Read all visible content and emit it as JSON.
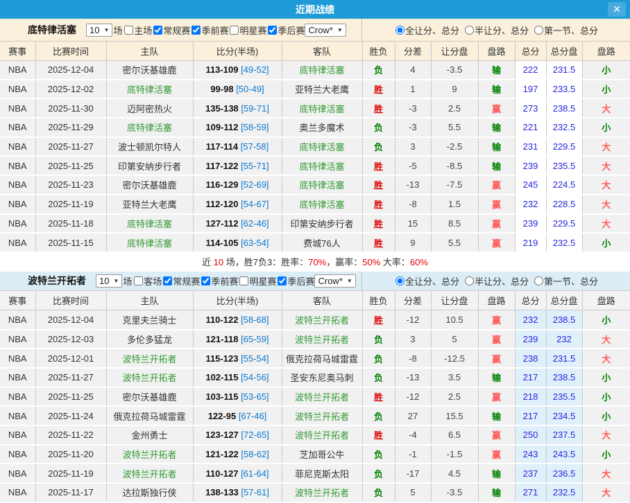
{
  "titlebar": {
    "title": "近期战绩",
    "close_icon": "✕"
  },
  "colors": {
    "titlebar_blue": "#1E9AD6",
    "section1_filter_bg": "#FAF0DB",
    "section2_filter_bg": "#DCEDF5",
    "row_bg": "#F1F1F1",
    "total_highlight_blue": "#DFF0FB",
    "win_red": "#DD0000",
    "lose_green": "#008000",
    "cover_light_red": "#FF5C5C",
    "total_value_blue": "#2626DD",
    "half_score_blue": "#0B76CC",
    "team_green": "#339933",
    "summary_red": "#E60000"
  },
  "columns": [
    "赛事",
    "比赛时间",
    "主队",
    "比分(半场)",
    "客队",
    "胜负",
    "分差",
    "让分盘",
    "盘路",
    "总分",
    "总分盘",
    "盘路"
  ],
  "sections": [
    {
      "team": "底特律活塞",
      "games_count": "10",
      "games_suffix": "场",
      "checkboxes": [
        {
          "label": "主场",
          "checked": false
        },
        {
          "label": "常规赛",
          "checked": true
        },
        {
          "label": "季前赛",
          "checked": true
        },
        {
          "label": "明星赛",
          "checked": false
        },
        {
          "label": "季后赛",
          "checked": true
        }
      ],
      "dropdown": "Crow*",
      "radios": [
        {
          "label": "全让分、总分",
          "checked": true
        },
        {
          "label": "半让分、总分",
          "checked": false
        },
        {
          "label": "第一节、总分",
          "checked": false
        }
      ],
      "rows": [
        {
          "league": "NBA",
          "date": "2025-12-04",
          "home": "密尔沃基雄鹿",
          "home_green": false,
          "score": "113-109",
          "half": "[49-52]",
          "away": "底特律活塞",
          "away_green": true,
          "result": "负",
          "diff": "4",
          "handicap": "-3.5",
          "handicap_result": "输",
          "total": "222",
          "total_line": "231.5",
          "ou": "小"
        },
        {
          "league": "NBA",
          "date": "2025-12-02",
          "home": "底特律活塞",
          "home_green": true,
          "score": "99-98",
          "half": "[50-49]",
          "away": "亚特兰大老鹰",
          "away_green": false,
          "result": "胜",
          "diff": "1",
          "handicap": "9",
          "handicap_result": "输",
          "total": "197",
          "total_line": "233.5",
          "ou": "小"
        },
        {
          "league": "NBA",
          "date": "2025-11-30",
          "home": "迈阿密热火",
          "home_green": false,
          "score": "135-138",
          "half": "[59-71]",
          "away": "底特律活塞",
          "away_green": true,
          "result": "胜",
          "diff": "-3",
          "handicap": "2.5",
          "handicap_result": "赢",
          "total": "273",
          "total_line": "238.5",
          "ou": "大"
        },
        {
          "league": "NBA",
          "date": "2025-11-29",
          "home": "底特律活塞",
          "home_green": true,
          "score": "109-112",
          "half": "[58-59]",
          "away": "奥兰多魔术",
          "away_green": false,
          "result": "负",
          "diff": "-3",
          "handicap": "5.5",
          "handicap_result": "输",
          "total": "221",
          "total_line": "232.5",
          "ou": "小"
        },
        {
          "league": "NBA",
          "date": "2025-11-27",
          "home": "波士顿凯尔特人",
          "home_green": false,
          "score": "117-114",
          "half": "[57-58]",
          "away": "底特律活塞",
          "away_green": true,
          "result": "负",
          "diff": "3",
          "handicap": "-2.5",
          "handicap_result": "输",
          "total": "231",
          "total_line": "229.5",
          "ou": "大"
        },
        {
          "league": "NBA",
          "date": "2025-11-25",
          "home": "印第安纳步行者",
          "home_green": false,
          "score": "117-122",
          "half": "[55-71]",
          "away": "底特律活塞",
          "away_green": true,
          "result": "胜",
          "diff": "-5",
          "handicap": "-8.5",
          "handicap_result": "输",
          "total": "239",
          "total_line": "235.5",
          "ou": "大"
        },
        {
          "league": "NBA",
          "date": "2025-11-23",
          "home": "密尔沃基雄鹿",
          "home_green": false,
          "score": "116-129",
          "half": "[52-69]",
          "away": "底特律活塞",
          "away_green": true,
          "result": "胜",
          "diff": "-13",
          "handicap": "-7.5",
          "handicap_result": "赢",
          "total": "245",
          "total_line": "224.5",
          "ou": "大"
        },
        {
          "league": "NBA",
          "date": "2025-11-19",
          "home": "亚特兰大老鹰",
          "home_green": false,
          "score": "112-120",
          "half": "[54-67]",
          "away": "底特律活塞",
          "away_green": true,
          "result": "胜",
          "diff": "-8",
          "handicap": "1.5",
          "handicap_result": "赢",
          "total": "232",
          "total_line": "228.5",
          "ou": "大"
        },
        {
          "league": "NBA",
          "date": "2025-11-18",
          "home": "底特律活塞",
          "home_green": true,
          "score": "127-112",
          "half": "[62-46]",
          "away": "印第安纳步行者",
          "away_green": false,
          "result": "胜",
          "diff": "15",
          "handicap": "8.5",
          "handicap_result": "赢",
          "total": "239",
          "total_line": "229.5",
          "ou": "大"
        },
        {
          "league": "NBA",
          "date": "2025-11-15",
          "home": "底特律活塞",
          "home_green": true,
          "score": "114-105",
          "half": "[63-54]",
          "away": "费城76人",
          "away_green": false,
          "result": "胜",
          "diff": "9",
          "handicap": "5.5",
          "handicap_result": "赢",
          "total": "219",
          "total_line": "232.5",
          "ou": "小"
        }
      ],
      "summary": [
        {
          "text": "近 ",
          "red": false
        },
        {
          "text": "10",
          "red": true
        },
        {
          "text": " 场，胜7负3：胜率：",
          "red": false
        },
        {
          "text": "70%",
          "red": true
        },
        {
          "text": "，赢率：",
          "red": false
        },
        {
          "text": "50%",
          "red": true
        },
        {
          "text": " 大率：",
          "red": false
        },
        {
          "text": "60%",
          "red": true
        }
      ]
    },
    {
      "team": "波特兰开拓者",
      "games_count": "10",
      "games_suffix": "场",
      "checkboxes": [
        {
          "label": "客场",
          "checked": false
        },
        {
          "label": "常规赛",
          "checked": true
        },
        {
          "label": "季前赛",
          "checked": true
        },
        {
          "label": "明星赛",
          "checked": false
        },
        {
          "label": "季后赛",
          "checked": true
        }
      ],
      "dropdown": "Crow*",
      "radios": [
        {
          "label": "全让分、总分",
          "checked": true
        },
        {
          "label": "半让分、总分",
          "checked": false
        },
        {
          "label": "第一节、总分",
          "checked": false
        }
      ],
      "rows": [
        {
          "league": "NBA",
          "date": "2025-12-04",
          "home": "克里夫兰骑士",
          "home_green": false,
          "score": "110-122",
          "half": "[58-68]",
          "away": "波特兰开拓者",
          "away_green": true,
          "result": "胜",
          "diff": "-12",
          "handicap": "10.5",
          "handicap_result": "赢",
          "total": "232",
          "total_line": "238.5",
          "ou": "小"
        },
        {
          "league": "NBA",
          "date": "2025-12-03",
          "home": "多伦多猛龙",
          "home_green": false,
          "score": "121-118",
          "half": "[65-59]",
          "away": "波特兰开拓者",
          "away_green": true,
          "result": "负",
          "diff": "3",
          "handicap": "5",
          "handicap_result": "赢",
          "total": "239",
          "total_line": "232",
          "ou": "大"
        },
        {
          "league": "NBA",
          "date": "2025-12-01",
          "home": "波特兰开拓者",
          "home_green": true,
          "score": "115-123",
          "half": "[55-54]",
          "away": "俄克拉荷马城雷霆",
          "away_green": false,
          "result": "负",
          "diff": "-8",
          "handicap": "-12.5",
          "handicap_result": "赢",
          "total": "238",
          "total_line": "231.5",
          "ou": "大"
        },
        {
          "league": "NBA",
          "date": "2025-11-27",
          "home": "波特兰开拓者",
          "home_green": true,
          "score": "102-115",
          "half": "[54-56]",
          "away": "圣安东尼奥马刺",
          "away_green": false,
          "result": "负",
          "diff": "-13",
          "handicap": "3.5",
          "handicap_result": "输",
          "total": "217",
          "total_line": "238.5",
          "ou": "小"
        },
        {
          "league": "NBA",
          "date": "2025-11-25",
          "home": "密尔沃基雄鹿",
          "home_green": false,
          "score": "103-115",
          "half": "[53-65]",
          "away": "波特兰开拓者",
          "away_green": true,
          "result": "胜",
          "diff": "-12",
          "handicap": "2.5",
          "handicap_result": "赢",
          "total": "218",
          "total_line": "235.5",
          "ou": "小"
        },
        {
          "league": "NBA",
          "date": "2025-11-24",
          "home": "俄克拉荷马城雷霆",
          "home_green": false,
          "score": "122-95",
          "half": "[67-46]",
          "away": "波特兰开拓者",
          "away_green": true,
          "result": "负",
          "diff": "27",
          "handicap": "15.5",
          "handicap_result": "输",
          "total": "217",
          "total_line": "234.5",
          "ou": "小"
        },
        {
          "league": "NBA",
          "date": "2025-11-22",
          "home": "金州勇士",
          "home_green": false,
          "score": "123-127",
          "half": "[72-65]",
          "away": "波特兰开拓者",
          "away_green": true,
          "result": "胜",
          "diff": "-4",
          "handicap": "6.5",
          "handicap_result": "赢",
          "total": "250",
          "total_line": "237.5",
          "ou": "大"
        },
        {
          "league": "NBA",
          "date": "2025-11-20",
          "home": "波特兰开拓者",
          "home_green": true,
          "score": "121-122",
          "half": "[58-62]",
          "away": "芝加哥公牛",
          "away_green": false,
          "result": "负",
          "diff": "-1",
          "handicap": "-1.5",
          "handicap_result": "赢",
          "total": "243",
          "total_line": "243.5",
          "ou": "小"
        },
        {
          "league": "NBA",
          "date": "2025-11-19",
          "home": "波特兰开拓者",
          "home_green": true,
          "score": "110-127",
          "half": "[61-64]",
          "away": "菲尼克斯太阳",
          "away_green": false,
          "result": "负",
          "diff": "-17",
          "handicap": "4.5",
          "handicap_result": "输",
          "total": "237",
          "total_line": "236.5",
          "ou": "大"
        },
        {
          "league": "NBA",
          "date": "2025-11-17",
          "home": "达拉斯独行侠",
          "home_green": false,
          "score": "138-133",
          "half": "[57-61]",
          "away": "波特兰开拓者",
          "away_green": true,
          "result": "负",
          "diff": "5",
          "handicap": "-3.5",
          "handicap_result": "输",
          "total": "271",
          "total_line": "232.5",
          "ou": "大"
        }
      ]
    }
  ]
}
